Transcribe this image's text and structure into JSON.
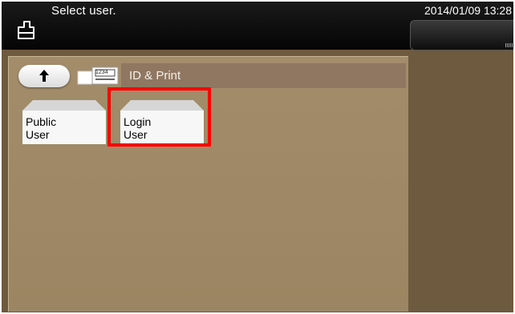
{
  "header": {
    "title": "Select user.",
    "datetime": "2014/01/09 13:28"
  },
  "nav": {
    "path_label": "ID & Print",
    "folder_number": "1234"
  },
  "users": [
    {
      "label": "Public\nUser"
    },
    {
      "label": "Login\nUser"
    }
  ],
  "colors": {
    "highlight": "#ff0000",
    "background": "#6e5a3e",
    "panel": "#a28c6a"
  },
  "icons": {
    "home": "printer-home-icon",
    "up": "up-arrow-icon",
    "folder": "folder-box-icon"
  }
}
